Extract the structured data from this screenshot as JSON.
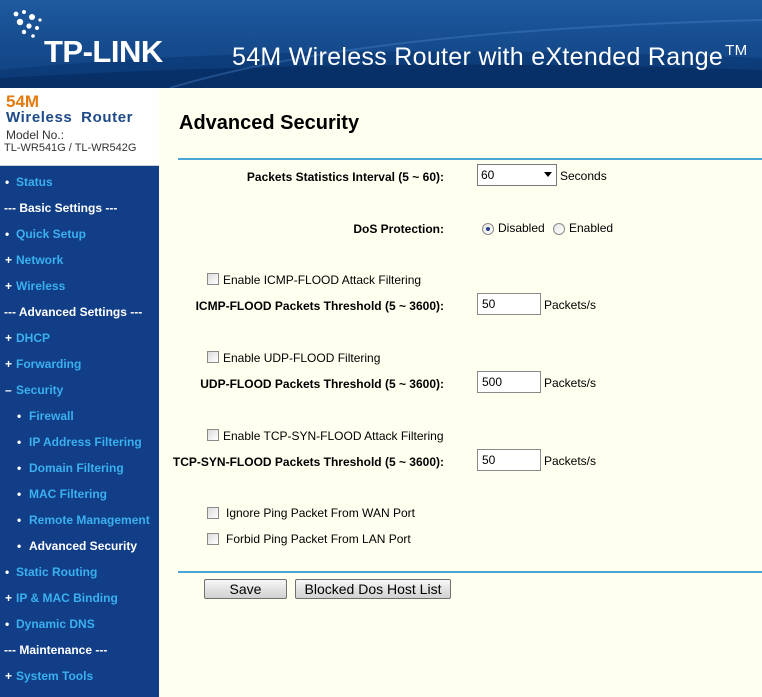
{
  "header": {
    "logo": "TP-LINK",
    "title": "54M Wireless Router with eXtended Range",
    "title_tm": "TM"
  },
  "model": {
    "line1": "54M",
    "line2": "Wireless Router",
    "line3": "Model No.:",
    "line4": "TL-WR541G / TL-WR542G"
  },
  "sidebar": {
    "items": [
      {
        "label": "Status",
        "kind": "top"
      },
      {
        "label": "--- Basic Settings ---",
        "kind": "section"
      },
      {
        "label": "Quick Setup",
        "kind": "top"
      },
      {
        "label": "Network",
        "kind": "top-plus"
      },
      {
        "label": "Wireless",
        "kind": "top-plus"
      },
      {
        "label": "--- Advanced Settings ---",
        "kind": "section"
      },
      {
        "label": "DHCP",
        "kind": "top-plus"
      },
      {
        "label": "Forwarding",
        "kind": "top-plus"
      },
      {
        "label": "Security",
        "kind": "top-minus"
      },
      {
        "label": "Firewall",
        "kind": "sub"
      },
      {
        "label": "IP Address Filtering",
        "kind": "sub"
      },
      {
        "label": "Domain Filtering",
        "kind": "sub"
      },
      {
        "label": "MAC Filtering",
        "kind": "sub"
      },
      {
        "label": "Remote Management",
        "kind": "sub"
      },
      {
        "label": "Advanced Security",
        "kind": "sub-active"
      },
      {
        "label": "Static Routing",
        "kind": "top"
      },
      {
        "label": "IP & MAC Binding",
        "kind": "top-plus"
      },
      {
        "label": "Dynamic DNS",
        "kind": "top"
      },
      {
        "label": "--- Maintenance ---",
        "kind": "section"
      },
      {
        "label": "System Tools",
        "kind": "top-plus"
      }
    ]
  },
  "main": {
    "title": "Advanced Security",
    "packets_interval_label": "Packets Statistics Interval (5 ~ 60):",
    "packets_interval_value": "60",
    "packets_interval_unit": "Seconds",
    "dos_label": "DoS Protection:",
    "dos_disabled": "Disabled",
    "dos_enabled": "Enabled",
    "icmp_enable": "Enable ICMP-FLOOD Attack Filtering",
    "icmp_threshold_label": "ICMP-FLOOD Packets Threshold (5 ~ 3600):",
    "icmp_threshold_value": "50",
    "udp_enable": "Enable UDP-FLOOD Filtering",
    "udp_threshold_label": "UDP-FLOOD Packets Threshold (5 ~ 3600):",
    "udp_threshold_value": "500",
    "tcp_enable": "Enable TCP-SYN-FLOOD Attack Filtering",
    "tcp_threshold_label": "TCP-SYN-FLOOD Packets Threshold (5 ~ 3600):",
    "tcp_threshold_value": "50",
    "unit_packets": "Packets/s",
    "ignore_ping_wan": "Ignore Ping Packet From WAN Port",
    "forbid_ping_lan": "Forbid Ping Packet From LAN Port",
    "save": "Save",
    "blocked_list": "Blocked Dos Host List"
  },
  "colors": {
    "header_blue": "#0e3f7f",
    "sidebar_blue": "#113e86",
    "link_blue": "#3ab0f0",
    "rule_blue": "#4aa6d8",
    "accent_orange": "#e47a0e"
  }
}
